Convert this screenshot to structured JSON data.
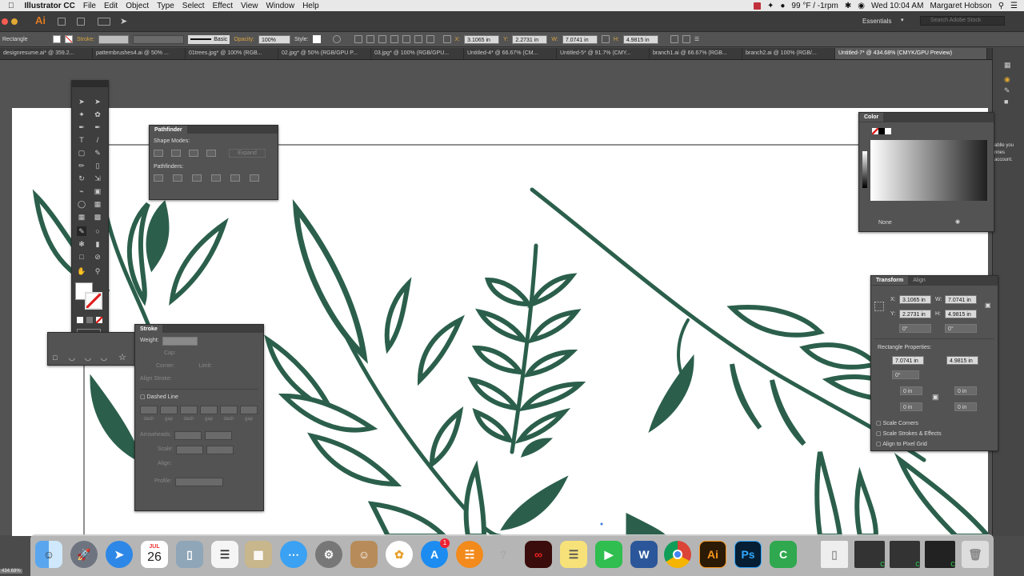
{
  "menubar": {
    "app_name": "Illustrator CC",
    "menus": [
      "File",
      "Edit",
      "Object",
      "Type",
      "Select",
      "Effect",
      "View",
      "Window",
      "Help"
    ],
    "weather": "99 °F / -1rpm",
    "clock": "Wed 10:04 AM",
    "user": "Margaret Hobson"
  },
  "appbar": {
    "logo": "Ai",
    "workspace": "Essentials",
    "search_placeholder": "Search Adobe Stock"
  },
  "control_bar": {
    "selection": "Rectangle",
    "stroke_label": "Stroke:",
    "brush": "Basic",
    "opacity_label": "Opacity:",
    "opacity": "100%",
    "style_label": "Style:",
    "x_label": "X:",
    "x": "3.1065 in",
    "y_label": "Y:",
    "y": "2.2731 in",
    "w_label": "W:",
    "w": "7.0741 in",
    "h_label": "H:",
    "h": "4.9815 in"
  },
  "doc_tabs": [
    "designresume.ai* @ 359.2...",
    "patternbrushes4.ai @ 50% ...",
    "01trees.jpg* @ 100% (RGB...",
    "02.jpg* @ 50% (RGB/GPU P...",
    "03.jpg* @ 100% (RGB/GPU...",
    "Untitled-4* @ 66.67% (CM...",
    "Untitled-5* @ 91.7% (CMY...",
    "branch1.ai @ 66.67% (RGB...",
    "branch2.ai @ 100% (RGB/...",
    "Untitled-7* @ 434.68% (CMYK/GPU Preview)"
  ],
  "pathfinder": {
    "title": "Pathfinder",
    "shape_modes": "Shape Modes:",
    "expand": "Expand",
    "pathfinders": "Pathfinders:"
  },
  "stroke_panel": {
    "title": "Stroke",
    "weight": "Weight:",
    "cap": "Cap:",
    "corner": "Corner:",
    "limit": "Limit:",
    "align_stroke": "Align Stroke:",
    "dashed_line": "Dashed Line",
    "dash_labels": [
      "dash",
      "gap",
      "dash",
      "gap",
      "dash",
      "gap"
    ],
    "arrowheads": "Arrowheads:",
    "scale": "Scale:",
    "align": "Align:",
    "profile": "Profile:"
  },
  "color_panel": {
    "title": "Color",
    "none": "None"
  },
  "transform_panel": {
    "tab1": "Transform",
    "tab2": "Align",
    "x": "3.1065 in",
    "y": "2.2731 in",
    "w": "7.0741 in",
    "h": "4.9815 in",
    "angle1": "0°",
    "angle2": "0°",
    "rect_props": "Rectangle Properties:",
    "rw": "7.0741 in",
    "rh": "4.9815 in",
    "rot": "0°",
    "c1": "0 in",
    "c2": "0 in",
    "c3": "0 in",
    "c4": "0 in",
    "scale_corners": "Scale Corners",
    "scale_strokes": "Scale Strokes & Effects",
    "align_pixel": "Align to Pixel Grid"
  },
  "side_text": [
    "ablle you",
    "nnes",
    "account."
  ],
  "zoom": "434.68%",
  "dock": {
    "calendar_month": "JUL",
    "calendar_day": "26",
    "appstore_badge": "1",
    "ai_label": "Ai",
    "ps_label": "Ps"
  },
  "colors": {
    "leaf": "#2b5f4c",
    "ui_bg": "#535353",
    "highlight": "#d9a441"
  }
}
